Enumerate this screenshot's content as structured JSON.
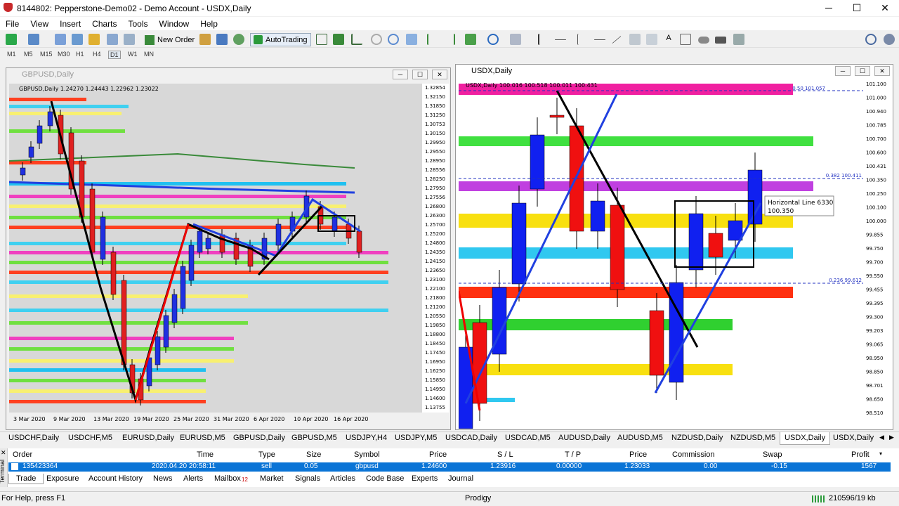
{
  "window": {
    "title": "8144802: Pepperstone-Demo02 - Demo Account - USDX,Daily",
    "min": "─",
    "max": "☐",
    "close": "✕"
  },
  "menu": [
    "File",
    "View",
    "Insert",
    "Charts",
    "Tools",
    "Window",
    "Help"
  ],
  "toolbar": {
    "new_order": "New Order",
    "autotrading": "AutoTrading"
  },
  "timeframes": [
    "M1",
    "M5",
    "M15",
    "M30",
    "H1",
    "H4",
    "D1",
    "W1",
    "MN"
  ],
  "chart_left": {
    "window_title": "GBPUSD,Daily",
    "info": "GBPUSD,Daily  1.24270 1.24443 1.22962 1.23022",
    "prices": [
      "1.32854",
      "1.32150",
      "1.31850",
      "1.31250",
      "1.30753",
      "1.30150",
      "1.29950",
      "1.29550",
      "1.28950",
      "1.28556",
      "1.28250",
      "1.27950",
      "1.27556",
      "1.26800",
      "1.26300",
      "1.25700",
      "1.25200",
      "1.24800",
      "1.24350",
      "1.24150",
      "1.23650",
      "1.23100",
      "1.22100",
      "1.21800",
      "1.21200",
      "1.20550",
      "1.19850",
      "1.18800",
      "1.18450",
      "1.17450",
      "1.16950",
      "1.16250",
      "1.15850",
      "1.14950",
      "1.14600",
      "1.13755"
    ],
    "dates": [
      "3 Mar 2020",
      "9 Mar 2020",
      "13 Mar 2020",
      "19 Mar 2020",
      "25 Mar 2020",
      "31 Mar 2020",
      "6 Apr 2020",
      "10 Apr 2020",
      "16 Apr 2020"
    ]
  },
  "chart_right": {
    "window_title": "USDX,Daily",
    "info": "USDX,Daily  100.016 100.518 100.011 100.431",
    "prices": [
      "101.100",
      "101.000",
      "100.940",
      "100.785",
      "100.700",
      "100.600",
      "100.431",
      "100.350",
      "100.250",
      "100.100",
      "100.000",
      "99.855",
      "99.750",
      "99.700",
      "99.550",
      "99.455",
      "99.395",
      "99.300",
      "99.203",
      "99.065",
      "98.950",
      "98.850",
      "98.701",
      "98.650",
      "98.510"
    ],
    "fib_labels": [
      "0.50  101.057",
      "0.382  100.411",
      "0.236  99.612"
    ],
    "tooltip_line1": "Horizontal Line 6330",
    "tooltip_line2": "100.350"
  },
  "tabs": [
    "USDCHF,Daily",
    "USDCHF,M5",
    "EURUSD,Daily",
    "EURUSD,M5",
    "GBPUSD,Daily",
    "GBPUSD,M5",
    "USDJPY,H4",
    "USDJPY,M5",
    "USDCAD,Daily",
    "USDCAD,M5",
    "AUDUSD,Daily",
    "AUDUSD,M5",
    "NZDUSD,Daily",
    "NZDUSD,M5",
    "USDX,Daily",
    "USDX,Daily"
  ],
  "terminal": {
    "side_label": "Terminal",
    "headers": [
      "Order",
      "Time",
      "Type",
      "Size",
      "Symbol",
      "Price",
      "S / L",
      "T / P",
      "Price",
      "Commission",
      "Swap",
      "Profit"
    ],
    "row": {
      "order": "135423364",
      "time": "2020.04.20 20:58:11",
      "type": "sell",
      "size": "0.05",
      "symbol": "gbpusd",
      "price": "1.24600",
      "sl": "1.23916",
      "tp": "0.00000",
      "cur_price": "1.23033",
      "commission": "0.00",
      "swap": "-0.15",
      "profit": "1567"
    },
    "tabs": [
      "Trade",
      "Exposure",
      "Account History",
      "News",
      "Alerts",
      "Mailbox",
      "Market",
      "Signals",
      "Articles",
      "Code Base",
      "Experts",
      "Journal"
    ],
    "mailbox_count": "12"
  },
  "status": {
    "help": "For Help, press F1",
    "profile": "Prodigy",
    "traffic": "210596/19 kb"
  }
}
